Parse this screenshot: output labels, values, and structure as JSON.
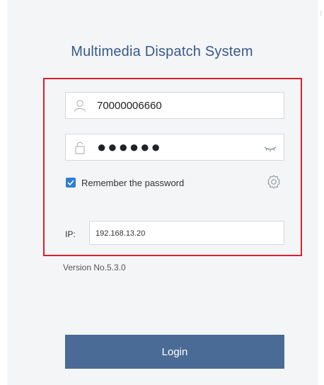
{
  "window": {
    "title": "Multimedia Dispatch System"
  },
  "form": {
    "username_value": "70000006660",
    "password_mask": "●●●●●●",
    "remember_label": "Remember the password",
    "remember_checked": true,
    "ip_label": "IP:",
    "ip_value": "192.168.13.20"
  },
  "footer": {
    "version_text": "Version No.5.3.0",
    "login_label": "Login"
  },
  "icons": {
    "user": "user-icon",
    "lock": "lock-icon",
    "eye": "eye-closed-icon",
    "gear": "gear-icon",
    "check": "check-icon"
  },
  "colors": {
    "accent": "#2e7fd6",
    "button": "#4a6b95",
    "title": "#375a8c",
    "highlight_border": "#d9212b"
  }
}
